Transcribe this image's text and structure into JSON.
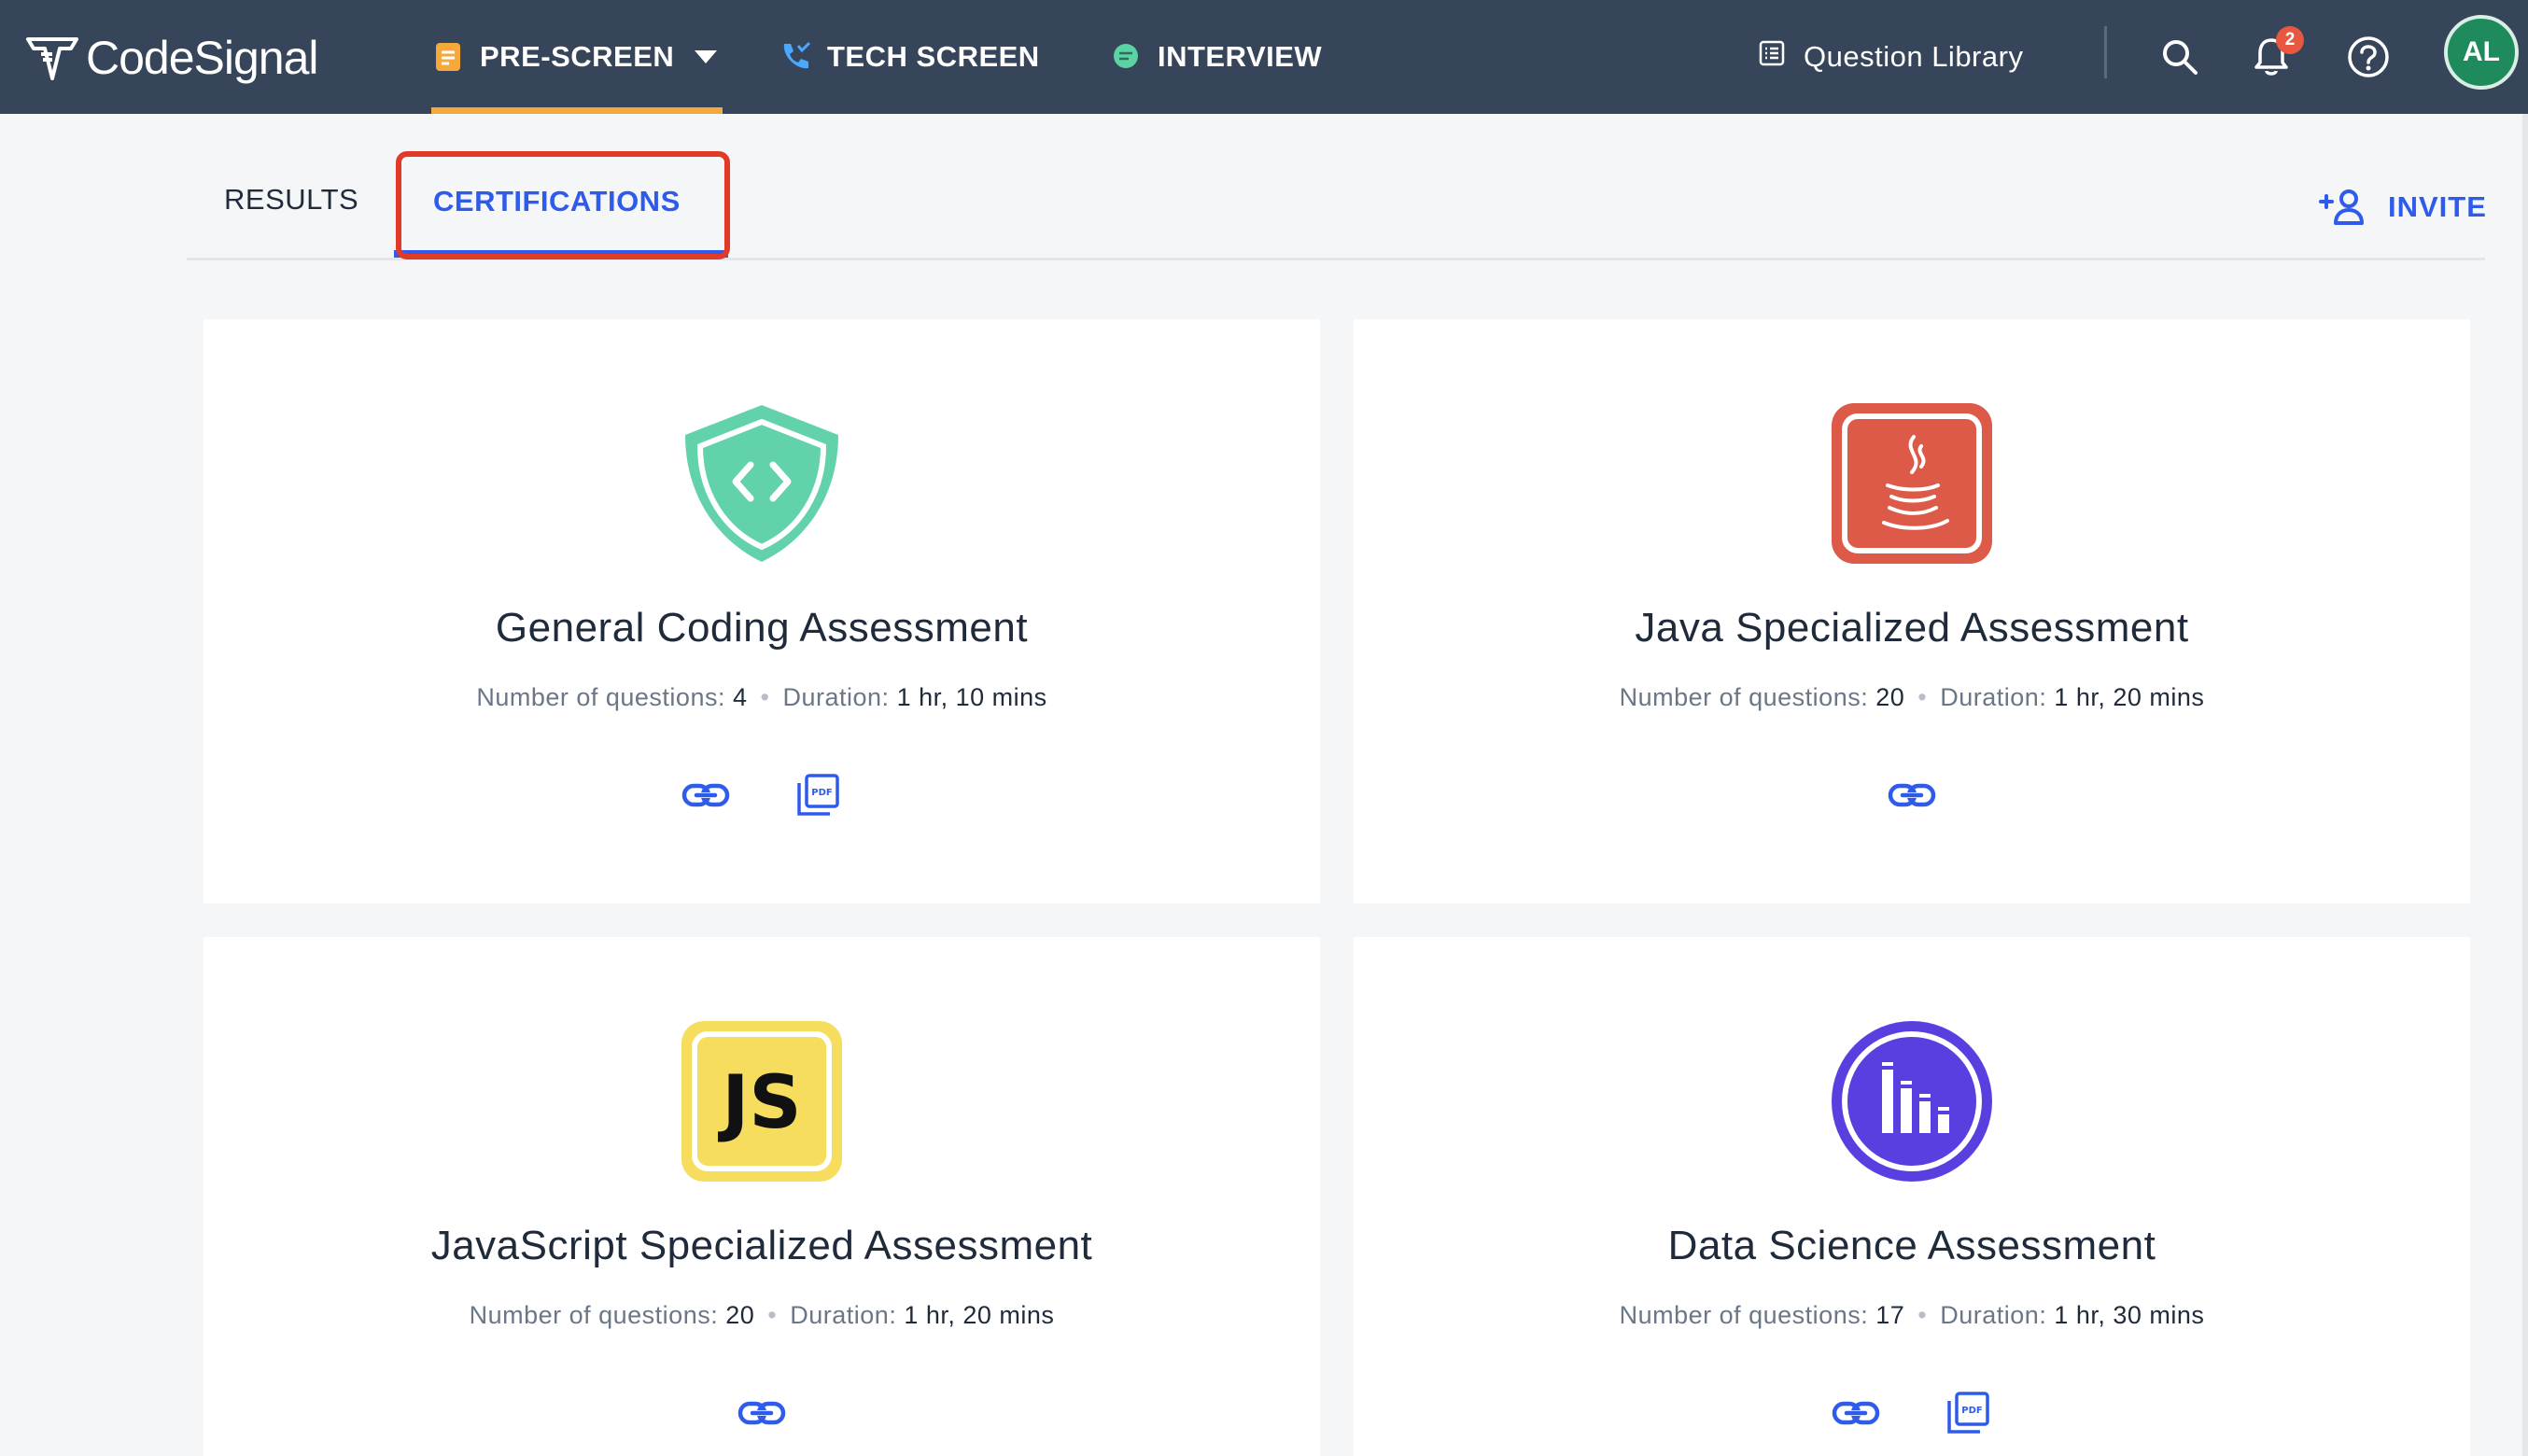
{
  "brand": {
    "name": "CodeSignal"
  },
  "nav": {
    "prescreen": "PRE-SCREEN",
    "tech_screen": "TECH SCREEN",
    "interview": "INTERVIEW",
    "question_library": "Question Library",
    "notifications_count": "2",
    "avatar_initials": "AL",
    "active_color": "#f4a93a"
  },
  "tabs": {
    "results": "RESULTS",
    "certifications": "CERTIFICATIONS",
    "active": "certifications"
  },
  "invite_label": "INVITE",
  "meta_labels": {
    "questions": "Number of questions:",
    "duration": "Duration:"
  },
  "cards": [
    {
      "title": "General Coding Assessment",
      "questions": "4",
      "duration": "1 hr, 10 mins",
      "icon": "shield-code-icon",
      "icon_color": "#62d2aa",
      "has_pdf": true
    },
    {
      "title": "Java Specialized Assessment",
      "questions": "20",
      "duration": "1 hr, 20 mins",
      "icon": "java-icon",
      "icon_color": "#dc5a47",
      "has_pdf": false
    },
    {
      "title": "JavaScript Specialized Assessment",
      "questions": "20",
      "duration": "1 hr, 20 mins",
      "icon": "javascript-icon",
      "icon_label": "JS",
      "icon_color": "#f6dd5e",
      "has_pdf": false
    },
    {
      "title": "Data Science Assessment",
      "questions": "17",
      "duration": "1 hr, 30 mins",
      "icon": "data-science-icon",
      "icon_color": "#5a3fe0",
      "has_pdf": true
    }
  ],
  "pdf_icon_label": "PDF",
  "accent_color": "#2f5bea",
  "highlight_color": "#e23a26"
}
